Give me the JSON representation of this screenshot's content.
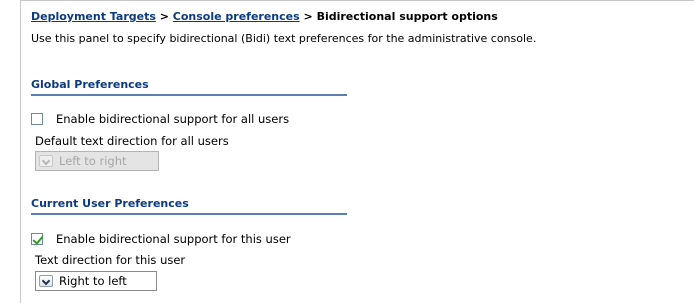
{
  "breadcrumb": {
    "link1": "Deployment Targets",
    "sep1": " > ",
    "link2": "Console preferences",
    "sep2": " > ",
    "current": "Bidirectional support options"
  },
  "description": "Use this panel to specify bidirectional (Bidi) text preferences for the administrative console.",
  "global": {
    "title": "Global Preferences",
    "enable_label": "Enable bidirectional support for all users",
    "enable_checked": false,
    "direction_label": "Default text direction for all users",
    "direction_value": "Left to right",
    "direction_enabled": false
  },
  "user": {
    "title": "Current User Preferences",
    "enable_label": "Enable bidirectional support for this user",
    "enable_checked": true,
    "direction_label": "Text direction for this user",
    "direction_value": "Right to left",
    "direction_enabled": true
  },
  "colors": {
    "link": "#0b3a7e",
    "section_rule": "#5a7fb0",
    "check": "#2f9e1f"
  },
  "icons": {
    "checkbox_checked": "checkmark-icon",
    "select": "chevron-down-icon"
  }
}
